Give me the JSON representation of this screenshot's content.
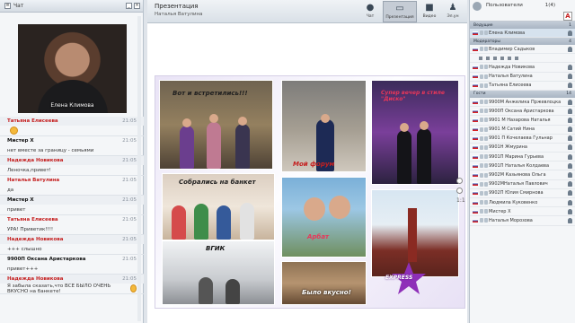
{
  "chat": {
    "title": "Чат",
    "video_name": "Елена Климова",
    "messages": [
      {
        "author": "Татьяна Елисеева",
        "color": "#c52020",
        "time": "21:05",
        "text": "",
        "emoji": true
      },
      {
        "author": "Мистер X",
        "color": "#111111",
        "time": "21:05",
        "text": "нет вместе за границу - семьями",
        "emoji": false
      },
      {
        "author": "Надежда Новикова",
        "color": "#c52020",
        "time": "21:05",
        "text": "Леночка,привет!",
        "emoji": false
      },
      {
        "author": "Наталья Ватулина",
        "color": "#c52020",
        "time": "21:05",
        "text": "да",
        "emoji": false
      },
      {
        "author": "Мистер X",
        "color": "#111111",
        "time": "21:05",
        "text": "привет",
        "emoji": false
      },
      {
        "author": "Татьяна Елисеева",
        "color": "#c52020",
        "time": "21:05",
        "text": "УРА! Приветик!!!!",
        "emoji": false
      },
      {
        "author": "Надежда Новикова",
        "color": "#c52020",
        "time": "21:05",
        "text": "+++ слышно",
        "emoji": false
      },
      {
        "author": "9900П Оксана Аристаркова",
        "color": "#111111",
        "time": "21:05",
        "text": "привет+++",
        "emoji": false
      },
      {
        "author": "Надежда Новикова",
        "color": "#c52020",
        "time": "21:05",
        "text": "Я забыла сказать,что ВСЕ БЫЛО ОЧЕНЬ ВКУСНО на банкете!",
        "emoji": true
      }
    ]
  },
  "presentation": {
    "title": "Презентация",
    "presenter": "Наталья Ватулина",
    "zoom_percent": "1:1",
    "toolbar": [
      {
        "label": "Чат",
        "icon": "chat-bubble-icon",
        "active": false
      },
      {
        "label": "Презентация",
        "icon": "presentation-board-icon",
        "active": true
      },
      {
        "label": "Видео",
        "icon": "video-camera-icon",
        "active": false
      },
      {
        "label": "Эл.ун",
        "icon": "person-board-icon",
        "active": false
      }
    ],
    "captions": {
      "c1": "Вот и встретились!!!",
      "c2": "Мой форум",
      "c3": "Супер вечер в стиле \"Диско\"",
      "c4": "Собрались на банкет",
      "c5": "Арбат",
      "c6": "ВГИК",
      "c7": "Было вкусно!",
      "logo": "EXPRESS"
    }
  },
  "users": {
    "title": "Пользователи",
    "count": "1(4)",
    "leading_head": "Ведущие",
    "leading_count": "1",
    "leading": [
      {
        "name": "Елена Климова",
        "selected": true
      }
    ],
    "moderators_head": "Модераторы",
    "moderators_count": "4",
    "moderators": [
      {
        "name": "Владимир Садыков"
      },
      {
        "name": "Надежда Новикова"
      },
      {
        "name": "Наталья Ватулина"
      },
      {
        "name": "Татьяна Елисеева"
      }
    ],
    "guests_head": "Гости",
    "guests_count": "14",
    "guests": [
      {
        "name": "9900М Анжелика Пржевлоцка"
      },
      {
        "name": "9900П Оксана Аристаркова"
      },
      {
        "name": "9901 М Назарова Наталья"
      },
      {
        "name": "9901 М Сатий Нина"
      },
      {
        "name": "9901 П Кочелаева Гульнар"
      },
      {
        "name": "9901Н Жмурина"
      },
      {
        "name": "9901П Марина Гурьева"
      },
      {
        "name": "9901П Наталья Колдаева"
      },
      {
        "name": "9902М Казьянова Ольга"
      },
      {
        "name": "9902МНаталья Павлович"
      },
      {
        "name": "9902П Юлия Смирнова"
      },
      {
        "name": "Людмила Куковенко"
      },
      {
        "name": "Мистер X"
      },
      {
        "name": "Наталья Морозова"
      }
    ]
  }
}
